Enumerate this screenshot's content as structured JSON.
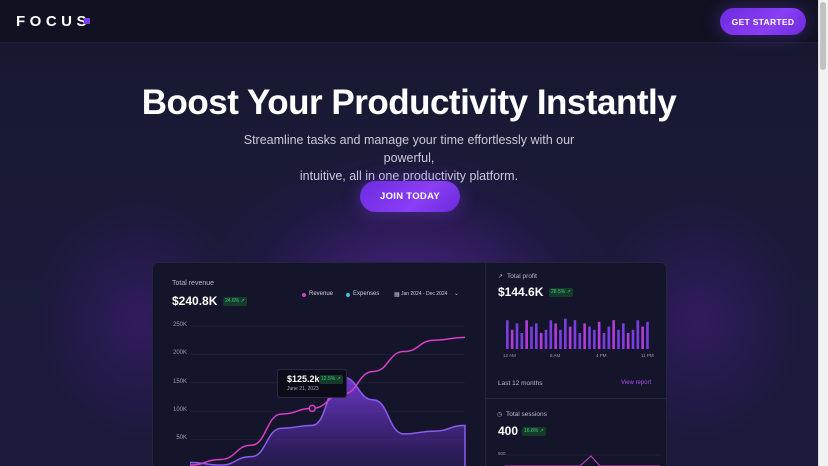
{
  "nav": {
    "logo": "FOCUS",
    "cta_label": "GET STARTED"
  },
  "hero": {
    "title": "Boost Your Productivity Instantly",
    "subtitle_line1": "Streamline tasks and manage your time effortlessly with our powerful,",
    "subtitle_line2": "intuitive, all in one productivity platform.",
    "cta_label": "JOIN TODAY"
  },
  "revenue_card": {
    "label": "Total revenue",
    "value": "$240.8K",
    "badge": "24.6% ↗",
    "legend": [
      "Revenue",
      "Expenses"
    ],
    "date_range": "Jan 2024 - Dec 2024",
    "y_ticks": [
      "250K",
      "200K",
      "150K",
      "100K",
      "50K"
    ],
    "tooltip_value": "$125.2k",
    "tooltip_badge": "12.5% ↗",
    "tooltip_date": "June 21, 2023"
  },
  "profit_card": {
    "label": "Total profit",
    "value": "$144.6K",
    "badge": "28.5% ↗",
    "x_ticks": [
      "12 AM",
      "8 AM",
      "4 PM",
      "11 PM"
    ],
    "period": "Last 12 months",
    "link": "View report"
  },
  "sessions_card": {
    "label": "Total sessions",
    "value": "400",
    "badge": "16.8% ↗",
    "y_tick": "500"
  },
  "colors": {
    "accent": "#8a3ef5",
    "revenue": "#d63fc7",
    "expenses": "#3cc2e0",
    "positive": "#38d27a"
  },
  "chart_data": [
    {
      "type": "line",
      "title": "Total revenue",
      "ylim": [
        0,
        250000
      ],
      "series": [
        {
          "name": "Revenue",
          "values": [
            5000,
            15000,
            40000,
            95000,
            105000,
            130000,
            170000,
            205000,
            225000,
            230000
          ]
        },
        {
          "name": "Expenses",
          "values": [
            10000,
            5000,
            20000,
            70000,
            75000,
            160000,
            120000,
            60000,
            65000,
            75000
          ]
        }
      ]
    },
    {
      "type": "bar",
      "title": "Total profit",
      "x": [
        "12 AM",
        "8 AM",
        "4 PM",
        "11 PM"
      ],
      "series": [
        {
          "name": "",
          "values": [
            0.9,
            0.6,
            0.8,
            0.5,
            0.9,
            0.7,
            0.8,
            0.5,
            0.6,
            0.9,
            0.8,
            0.6,
            0.95,
            0.7,
            0.9,
            0.5,
            0.8,
            0.7,
            0.6,
            0.85,
            0.5,
            0.7,
            0.9,
            0.6,
            0.8,
            0.5,
            0.6,
            0.9,
            0.7,
            0.85
          ]
        }
      ]
    }
  ]
}
